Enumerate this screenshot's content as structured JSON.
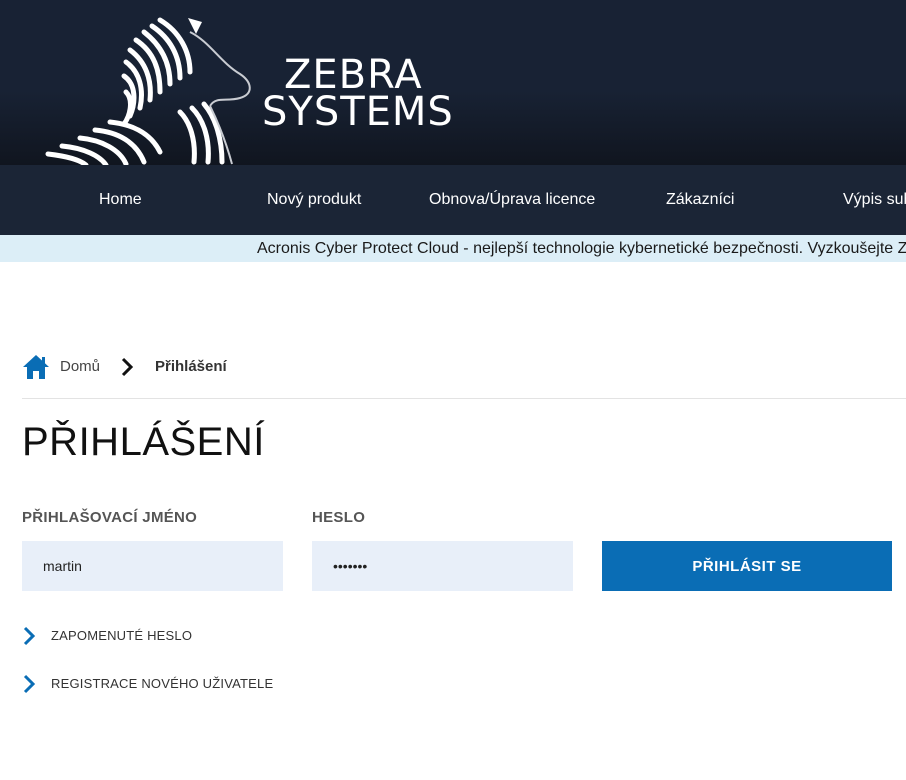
{
  "brand": {
    "line1": "ZEBRA",
    "line2": "SYSTEMS",
    "logo_icon": "zebra-logo"
  },
  "nav": {
    "items": [
      {
        "label": "Home"
      },
      {
        "label": "Nový produkt"
      },
      {
        "label": "Obnova/Úprava licence"
      },
      {
        "label": "Zákazníci"
      },
      {
        "label": "Výpis sub"
      }
    ]
  },
  "ticker": {
    "text": "Acronis Cyber Protect Cloud - nejlepší technologie kybernetické bezpečnosti. Vyzkoušejte ZD"
  },
  "breadcrumb": {
    "home_icon": "home-icon",
    "home_label": "Domů",
    "separator_icon": "chevron-right-icon",
    "current": "Přihlášení"
  },
  "page": {
    "title": "PŘIHLÁŠENÍ"
  },
  "form": {
    "username_label": "PŘIHLAŠOVACÍ JMÉNO",
    "username_value": "martin",
    "password_label": "HESLO",
    "password_value": "•••••••",
    "submit_label": "PŘIHLÁSIT SE"
  },
  "links": [
    {
      "label": "ZAPOMENUTÉ HESLO",
      "icon": "chevron-right-icon"
    },
    {
      "label": "REGISTRACE NOVÉHO UŽIVATELE",
      "icon": "chevron-right-icon"
    }
  ],
  "colors": {
    "header": "#182234",
    "nav": "#1b2536",
    "ticker": "#dceef7",
    "accent": "#0a6db5",
    "input_bg": "#e8eff9"
  }
}
